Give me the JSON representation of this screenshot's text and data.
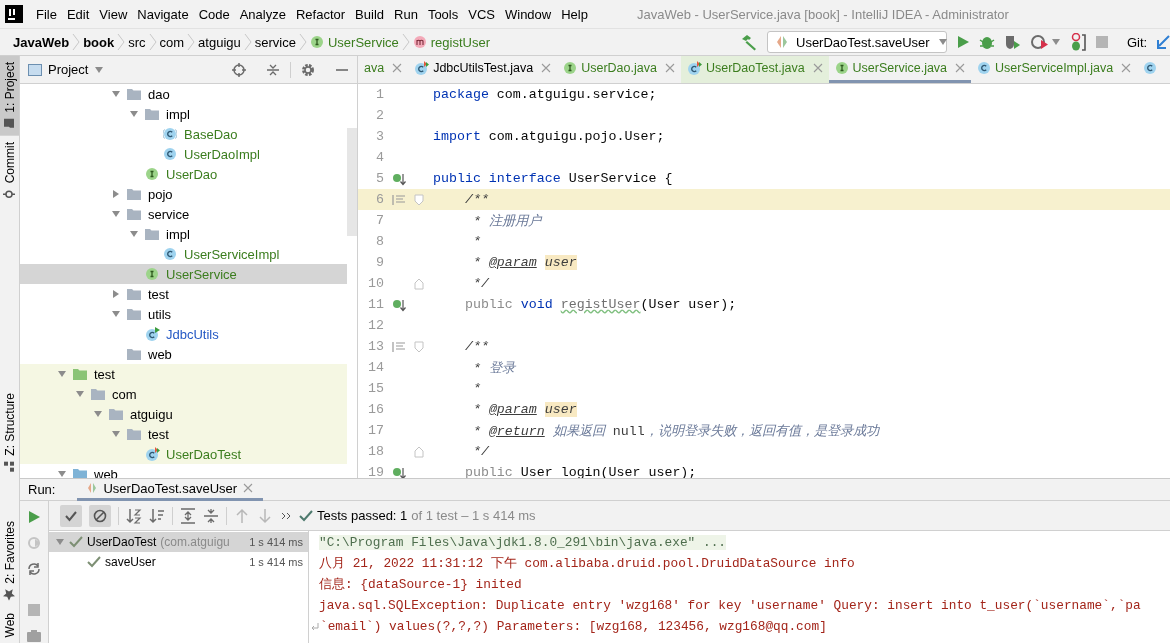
{
  "menu_bar": {
    "items": [
      "File",
      "Edit",
      "View",
      "Navigate",
      "Code",
      "Analyze",
      "Refactor",
      "Build",
      "Run",
      "Tools",
      "VCS",
      "Window",
      "Help"
    ],
    "window_title": "JavaWeb - UserService.java [book] - IntelliJ IDEA - Administrator"
  },
  "breadcrumbs": [
    {
      "label": "JavaWeb",
      "kind": "project"
    },
    {
      "label": "book",
      "kind": "project"
    },
    {
      "label": "src",
      "kind": "folder"
    },
    {
      "label": "com",
      "kind": "folder"
    },
    {
      "label": "atguigu",
      "kind": "folder"
    },
    {
      "label": "service",
      "kind": "folder"
    },
    {
      "label": "UserService",
      "kind": "interface"
    },
    {
      "label": "registUser",
      "kind": "method"
    }
  ],
  "run_toolbar": {
    "configuration": "UserDaoTest.saveUser",
    "vcs_label": "Git:"
  },
  "tool_windows": [
    {
      "label": "1: Project",
      "kind": "project",
      "selected": true
    },
    {
      "label": "Commit",
      "kind": "commit",
      "selected": false
    },
    {
      "label": "Z: Structure",
      "kind": "structure",
      "selected": false
    },
    {
      "label": "2: Favorites",
      "kind": "favorites",
      "selected": false
    },
    {
      "label": "Web",
      "kind": "web",
      "selected": false
    }
  ],
  "project_panel": {
    "title": "Project",
    "tree": [
      {
        "children": [
          {
            "children": [
              {
                "children": [
                  {
                    "label": "dao",
                    "kind": "folder",
                    "expanded": true,
                    "selected": false,
                    "children": [
                      {
                        "label": "impl",
                        "kind": "folder",
                        "expanded": true,
                        "selected": false,
                        "children": [
                          {
                            "label": "BaseDao",
                            "kind": "abstract-class",
                            "color": "#3b7d1e",
                            "selected": false
                          },
                          {
                            "label": "UserDaoImpl",
                            "kind": "class",
                            "color": "#3b7d1e",
                            "selected": false
                          }
                        ]
                      },
                      {
                        "label": "UserDao",
                        "kind": "interface",
                        "color": "#3b7d1e",
                        "selected": false
                      }
                    ]
                  },
                  {
                    "label": "pojo",
                    "kind": "folder",
                    "expanded": false,
                    "selected": false
                  },
                  {
                    "label": "service",
                    "kind": "folder",
                    "expanded": true,
                    "selected": false,
                    "children": [
                      {
                        "label": "impl",
                        "kind": "folder",
                        "expanded": true,
                        "selected": false,
                        "children": [
                          {
                            "label": "UserServiceImpl",
                            "kind": "class",
                            "color": "#3b7d1e",
                            "selected": false
                          }
                        ]
                      },
                      {
                        "label": "UserService",
                        "kind": "interface",
                        "color": "#3b7d1e",
                        "selected": true
                      }
                    ]
                  },
                  {
                    "label": "test",
                    "kind": "folder",
                    "expanded": false,
                    "selected": false
                  },
                  {
                    "label": "utils",
                    "kind": "folder",
                    "expanded": true,
                    "selected": false,
                    "children": [
                      {
                        "label": "JdbcUtils",
                        "kind": "runnable-class",
                        "color": "#2458c4",
                        "selected": false
                      }
                    ]
                  },
                  {
                    "label": "web",
                    "kind": "folder",
                    "selected": false
                  }
                ]
              }
            ]
          }
        ]
      },
      {
        "label": "test",
        "kind": "test-root",
        "expanded": true,
        "selected": false,
        "children": [
          {
            "label": "com",
            "kind": "folder",
            "expanded": true,
            "selected": false,
            "children": [
              {
                "label": "atguigu",
                "kind": "folder",
                "expanded": true,
                "selected": false,
                "children": [
                  {
                    "label": "test",
                    "kind": "folder",
                    "expanded": true,
                    "selected": false,
                    "children": [
                      {
                        "label": "UserDaoTest",
                        "kind": "test-class",
                        "color": "#3b7d1e",
                        "selected": false
                      }
                    ]
                  }
                ]
              }
            ]
          }
        ]
      },
      {
        "label": "web",
        "kind": "web-folder",
        "expanded": true,
        "selected": false
      }
    ]
  },
  "editor": {
    "tabs": [
      {
        "label": "ava",
        "color": "#3b7d1e",
        "test_scope": false,
        "selected": false
      },
      {
        "label": "JdbcUtilsTest.java",
        "kind": "test-class",
        "color": "#000000",
        "test_scope": false,
        "selected": false
      },
      {
        "label": "UserDao.java",
        "kind": "interface",
        "color": "#3b7d1e",
        "test_scope": false,
        "selected": false
      },
      {
        "label": "UserDaoTest.java",
        "kind": "test-class",
        "color": "#3b7d1e",
        "test_scope": true,
        "selected": false
      },
      {
        "label": "UserService.java",
        "kind": "interface",
        "color": "#3b7d1e",
        "test_scope": false,
        "selected": true
      },
      {
        "label": "UserServiceImpl.java",
        "kind": "class",
        "color": "#3b7d1e",
        "test_scope": false,
        "selected": false
      },
      {
        "kind": "class",
        "test_scope": false,
        "selected": false
      }
    ],
    "lines": [
      {
        "number": "1",
        "current": false,
        "segments": [
          {
            "text": "package",
            "kind": "keyword"
          },
          {
            "text": " com.atguigu.service;",
            "kind": "plain"
          }
        ]
      },
      {
        "number": "2",
        "current": false
      },
      {
        "number": "3",
        "current": false,
        "segments": [
          {
            "text": "import",
            "kind": "keyword"
          },
          {
            "text": " com.atguigu.pojo.User;",
            "kind": "plain"
          }
        ]
      },
      {
        "number": "4",
        "current": false
      },
      {
        "number": "5",
        "current": false,
        "marker": {
          "kind": "implemented"
        },
        "segments": [
          {
            "text": "public interface",
            "kind": "keyword"
          },
          {
            "text": " UserService {",
            "kind": "plain"
          }
        ]
      },
      {
        "number": "6",
        "current": true,
        "marker": {
          "kind": "doc"
        },
        "fold": {
          "kind": "start"
        },
        "segments": [
          {
            "text": "    /**",
            "kind": "doc"
          }
        ]
      },
      {
        "number": "7",
        "current": false,
        "segments": [
          {
            "text": "     * ",
            "kind": "doc"
          },
          {
            "text": "注册用户",
            "kind": "doc-text"
          }
        ]
      },
      {
        "number": "8",
        "current": false,
        "segments": [
          {
            "text": "     *",
            "kind": "doc"
          }
        ]
      },
      {
        "number": "9",
        "current": false,
        "segments": [
          {
            "text": "     * ",
            "kind": "doc"
          },
          {
            "text": "@param ",
            "kind": "doc-tag"
          },
          {
            "text": "user",
            "kind": "doc-param"
          }
        ]
      },
      {
        "number": "10",
        "current": false,
        "fold": {
          "kind": "end"
        },
        "segments": [
          {
            "text": "     */",
            "kind": "doc"
          }
        ]
      },
      {
        "number": "11",
        "current": false,
        "marker": {
          "kind": "implemented"
        },
        "segments": [
          {
            "text": "    public",
            "kind": "redundant"
          },
          {
            "text": " void ",
            "kind": "keyword"
          },
          {
            "text": "registUser",
            "kind": "typo"
          },
          {
            "text": "(User user);",
            "kind": "plain"
          }
        ]
      },
      {
        "number": "12",
        "current": false
      },
      {
        "number": "13",
        "current": false,
        "marker": {
          "kind": "doc"
        },
        "fold": {
          "kind": "start"
        },
        "segments": [
          {
            "text": "    /**",
            "kind": "doc"
          }
        ]
      },
      {
        "number": "14",
        "current": false,
        "segments": [
          {
            "text": "     * ",
            "kind": "doc"
          },
          {
            "text": "登录",
            "kind": "doc-text"
          }
        ]
      },
      {
        "number": "15",
        "current": false,
        "segments": [
          {
            "text": "     *",
            "kind": "doc"
          }
        ]
      },
      {
        "number": "16",
        "current": false,
        "segments": [
          {
            "text": "     * ",
            "kind": "doc"
          },
          {
            "text": "@param ",
            "kind": "doc-tag"
          },
          {
            "text": "user",
            "kind": "doc-param"
          }
        ]
      },
      {
        "number": "17",
        "current": false,
        "segments": [
          {
            "text": "     * ",
            "kind": "doc"
          },
          {
            "text": "@return ",
            "kind": "doc-tag"
          },
          {
            "text": "如果返回 ",
            "kind": "doc-text"
          },
          {
            "text": "null",
            "kind": "doc-code"
          },
          {
            "text": "，说明登录失败，返回有值，是登录成功",
            "kind": "doc-text"
          }
        ]
      },
      {
        "number": "18",
        "current": false,
        "fold": {
          "kind": "end"
        },
        "segments": [
          {
            "text": "     */",
            "kind": "doc"
          }
        ]
      },
      {
        "number": "19",
        "current": false,
        "marker": {
          "kind": "implemented"
        },
        "segments": [
          {
            "text": "    public",
            "kind": "redundant"
          },
          {
            "text": " User login(User user);",
            "kind": "plain"
          }
        ]
      }
    ]
  },
  "run_panel": {
    "label": "Run:",
    "tabs": [
      {
        "label": "UserDaoTest.saveUser",
        "selected": true
      }
    ],
    "filters": [
      {
        "kind": "show-passed",
        "selected": true
      },
      {
        "kind": "show-ignored",
        "selected": true
      }
    ],
    "summary": "Tests passed: 1",
    "summary_detail": "of 1 test – 1 s 414 ms",
    "tests": [
      {
        "label": "UserDaoTest",
        "detail": "(com.atguigu",
        "time": "1 s 414 ms",
        "passed": true,
        "expanded": true,
        "selected": true,
        "children": [
          {
            "label": "saveUser",
            "time": "1 s 414 ms",
            "passed": true,
            "selected": false
          }
        ]
      }
    ],
    "console": [
      {
        "text": "\"C:\\Program Files\\Java\\jdk1.8.0_291\\bin\\java.exe\" ...",
        "kind": "command"
      },
      {
        "text": "八月 21, 2022 11:31:12 下午 com.alibaba.druid.pool.DruidDataSource info",
        "kind": "stderr"
      },
      {
        "text": "信息: {dataSource-1} inited",
        "kind": "stderr"
      },
      {
        "text": "java.sql.SQLException: Duplicate entry 'wzg168' for key 'username' Query: insert into t_user(`username`,`pa",
        "kind": "stderr"
      },
      {
        "text": "`email`) values(?,?,?) Parameters: [wzg168, 123456, wzg168@qq.com]",
        "kind": "stderr",
        "wrapped": true
      }
    ]
  }
}
